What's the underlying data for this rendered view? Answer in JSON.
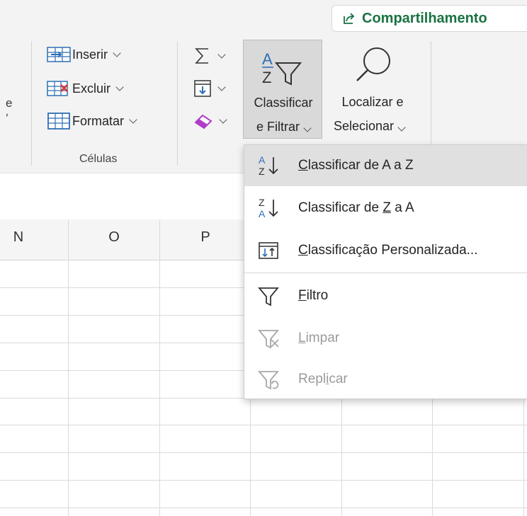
{
  "ribbon": {
    "share_label": "Compartilhamento",
    "partial_label_1": "e",
    "partial_label_2": "ʼ",
    "cells_group": {
      "insert_label": "Inserir",
      "delete_label": "Excluir",
      "format_label": "Formatar",
      "group_label": "Células"
    },
    "sort_filter": {
      "line1": "Classificar",
      "line2": "e Filtrar"
    },
    "find_select": {
      "line1": "Localizar e",
      "line2": "Selecionar"
    }
  },
  "columns": [
    "N",
    "O",
    "P"
  ],
  "menu": {
    "items": [
      {
        "pre": "",
        "acc": "C",
        "post": "lassificar de A a Z",
        "icon": "sort-a-to-z-icon",
        "state": "highlighted"
      },
      {
        "pre": "Classificar de ",
        "acc": "Z",
        "post": " a A",
        "icon": "sort-z-to-a-icon",
        "state": "enabled"
      },
      {
        "pre": "",
        "acc": "C",
        "post": "lassificação Personalizada...",
        "icon": "custom-sort-icon",
        "state": "enabled"
      },
      {
        "pre": "",
        "acc": "F",
        "post": "iltro",
        "icon": "filter-icon",
        "state": "enabled"
      },
      {
        "pre": "",
        "acc": "L",
        "post": "impar",
        "icon": "clear-filter-icon",
        "state": "disabled"
      },
      {
        "pre": "Repl",
        "acc": "i",
        "post": "car",
        "icon": "reapply-filter-icon",
        "state": "disabled"
      }
    ]
  },
  "colors": {
    "share_green": "#1a7343",
    "highlight": "#e0e0e0",
    "disabled_text": "#9a9a9a",
    "sort_blue": "#2e6fb5",
    "delete_red": "#e0342b",
    "eraser_purple": "#b03cc7"
  }
}
